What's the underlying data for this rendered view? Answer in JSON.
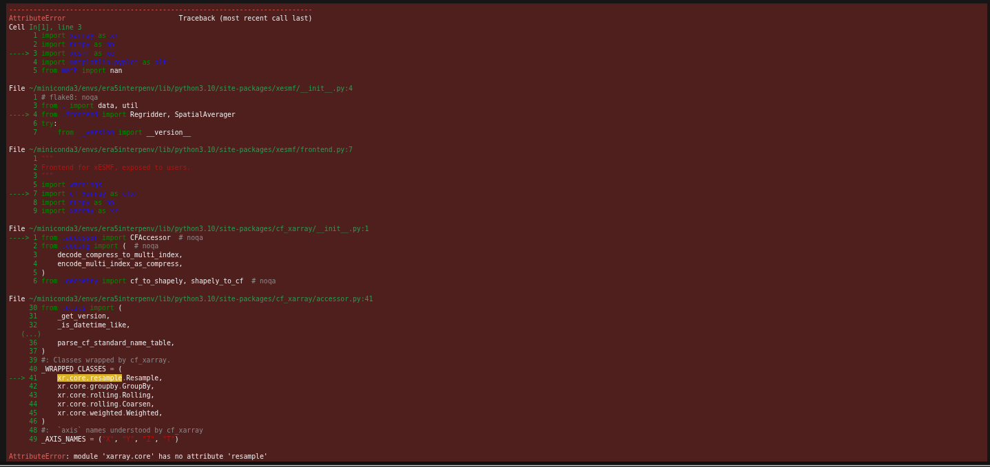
{
  "traceback": {
    "blocks": [
      {
        "lines": [
          {
            "segments": [
              {
                "kind": "err",
                "text": "---------------------------------------------------------------------------"
              }
            ]
          },
          {
            "segments": [
              {
                "kind": "err",
                "text": "AttributeError"
              },
              {
                "kind": "plain",
                "text": "                            Traceback (most recent call last)"
              }
            ]
          },
          {
            "segments": [
              {
                "kind": "plain",
                "text": "Cell "
              },
              {
                "kind": "path",
                "text": "In[1], line 3"
              }
            ]
          },
          {
            "segments": [
              {
                "kind": "num",
                "text": "      1 "
              },
              {
                "kind": "kw",
                "text": "import"
              },
              {
                "kind": "mod",
                "text": " xarray"
              },
              {
                "kind": "kw",
                "text": " as"
              },
              {
                "kind": "mod",
                "text": " xr"
              }
            ]
          },
          {
            "segments": [
              {
                "kind": "num",
                "text": "      2 "
              },
              {
                "kind": "kw",
                "text": "import"
              },
              {
                "kind": "mod",
                "text": " numpy"
              },
              {
                "kind": "kw",
                "text": " as"
              },
              {
                "kind": "mod",
                "text": " np"
              }
            ]
          },
          {
            "segments": [
              {
                "kind": "num",
                "text": "----> 3 "
              },
              {
                "kind": "kw",
                "text": "import"
              },
              {
                "kind": "mod",
                "text": " xesmf"
              },
              {
                "kind": "kw",
                "text": " as"
              },
              {
                "kind": "mod",
                "text": " xe"
              }
            ]
          },
          {
            "segments": [
              {
                "kind": "num",
                "text": "      4 "
              },
              {
                "kind": "kw",
                "text": "import"
              },
              {
                "kind": "mod",
                "text": " matplotlib.pyplot"
              },
              {
                "kind": "kw",
                "text": " as"
              },
              {
                "kind": "mod",
                "text": " plt"
              }
            ]
          },
          {
            "segments": [
              {
                "kind": "num",
                "text": "      5 "
              },
              {
                "kind": "kw",
                "text": "from"
              },
              {
                "kind": "mod",
                "text": " math"
              },
              {
                "kind": "kw",
                "text": " import"
              },
              {
                "kind": "plain",
                "text": " nan"
              }
            ]
          }
        ]
      },
      {
        "lines": [
          {
            "segments": [
              {
                "kind": "plain",
                "text": "File "
              },
              {
                "kind": "path",
                "text": "~/miniconda3/envs/era5interpenv/lib/python3.10/site-packages/xesmf/__init__.py:4"
              }
            ]
          },
          {
            "segments": [
              {
                "kind": "num",
                "text": "      1 "
              },
              {
                "kind": "cm",
                "text": "# flake8: noqa"
              }
            ]
          },
          {
            "segments": [
              {
                "kind": "num",
                "text": "      3 "
              },
              {
                "kind": "kw",
                "text": "from"
              },
              {
                "kind": "mod",
                "text": " ."
              },
              {
                "kind": "kw",
                "text": " import"
              },
              {
                "kind": "plain",
                "text": " data, util"
              }
            ]
          },
          {
            "segments": [
              {
                "kind": "num",
                "text": "----> 4 "
              },
              {
                "kind": "kw",
                "text": "from"
              },
              {
                "kind": "mod",
                "text": " .frontend"
              },
              {
                "kind": "kw",
                "text": " import"
              },
              {
                "kind": "plain",
                "text": " Regridder, SpatialAverager"
              }
            ]
          },
          {
            "segments": [
              {
                "kind": "num",
                "text": "      6 "
              },
              {
                "kind": "kw",
                "text": "try"
              },
              {
                "kind": "plain",
                "text": ":"
              }
            ]
          },
          {
            "segments": [
              {
                "kind": "num",
                "text": "      7     "
              },
              {
                "kind": "kw",
                "text": "from"
              },
              {
                "kind": "mod",
                "text": " ._version"
              },
              {
                "kind": "kw",
                "text": " import"
              },
              {
                "kind": "plain",
                "text": " __version__"
              }
            ]
          }
        ]
      },
      {
        "lines": [
          {
            "segments": [
              {
                "kind": "plain",
                "text": "File "
              },
              {
                "kind": "path",
                "text": "~/miniconda3/envs/era5interpenv/lib/python3.10/site-packages/xesmf/frontend.py:7"
              }
            ]
          },
          {
            "segments": [
              {
                "kind": "num",
                "text": "      1 "
              },
              {
                "kind": "str",
                "text": "\"\"\""
              }
            ]
          },
          {
            "segments": [
              {
                "kind": "num",
                "text": "      2 "
              },
              {
                "kind": "str",
                "text": "Frontend for xESMF, exposed to users."
              }
            ]
          },
          {
            "segments": [
              {
                "kind": "num",
                "text": "      3 "
              },
              {
                "kind": "str",
                "text": "\"\"\""
              }
            ]
          },
          {
            "segments": [
              {
                "kind": "num",
                "text": "      5 "
              },
              {
                "kind": "kw",
                "text": "import"
              },
              {
                "kind": "mod",
                "text": " warnings"
              }
            ]
          },
          {
            "segments": [
              {
                "kind": "num",
                "text": "----> 7 "
              },
              {
                "kind": "kw",
                "text": "import"
              },
              {
                "kind": "mod",
                "text": " cf_xarray"
              },
              {
                "kind": "kw",
                "text": " as"
              },
              {
                "kind": "mod",
                "text": " cfxr"
              }
            ]
          },
          {
            "segments": [
              {
                "kind": "num",
                "text": "      8 "
              },
              {
                "kind": "kw",
                "text": "import"
              },
              {
                "kind": "mod",
                "text": " numpy"
              },
              {
                "kind": "kw",
                "text": " as"
              },
              {
                "kind": "mod",
                "text": " np"
              }
            ]
          },
          {
            "segments": [
              {
                "kind": "num",
                "text": "      9 "
              },
              {
                "kind": "kw",
                "text": "import"
              },
              {
                "kind": "mod",
                "text": " xarray"
              },
              {
                "kind": "kw",
                "text": " as"
              },
              {
                "kind": "mod",
                "text": " xr"
              }
            ]
          }
        ]
      },
      {
        "lines": [
          {
            "segments": [
              {
                "kind": "plain",
                "text": "File "
              },
              {
                "kind": "path",
                "text": "~/miniconda3/envs/era5interpenv/lib/python3.10/site-packages/cf_xarray/__init__.py:1"
              }
            ]
          },
          {
            "segments": [
              {
                "kind": "num",
                "text": "----> 1 "
              },
              {
                "kind": "kw",
                "text": "from"
              },
              {
                "kind": "mod",
                "text": " .accessor"
              },
              {
                "kind": "kw",
                "text": " import"
              },
              {
                "kind": "plain",
                "text": " CFAccessor  "
              },
              {
                "kind": "cm",
                "text": "# noqa"
              }
            ]
          },
          {
            "segments": [
              {
                "kind": "num",
                "text": "      2 "
              },
              {
                "kind": "kw",
                "text": "from"
              },
              {
                "kind": "mod",
                "text": " .coding"
              },
              {
                "kind": "kw",
                "text": " import"
              },
              {
                "kind": "plain",
                "text": " (  "
              },
              {
                "kind": "cm",
                "text": "# noqa"
              }
            ]
          },
          {
            "segments": [
              {
                "kind": "num",
                "text": "      3 "
              },
              {
                "kind": "plain",
                "text": "    decode_compress_to_multi_index,"
              }
            ]
          },
          {
            "segments": [
              {
                "kind": "num",
                "text": "      4 "
              },
              {
                "kind": "plain",
                "text": "    encode_multi_index_as_compress,"
              }
            ]
          },
          {
            "segments": [
              {
                "kind": "num",
                "text": "      5 "
              },
              {
                "kind": "plain",
                "text": ")"
              }
            ]
          },
          {
            "segments": [
              {
                "kind": "num",
                "text": "      6 "
              },
              {
                "kind": "kw",
                "text": "from"
              },
              {
                "kind": "mod",
                "text": " .geometry"
              },
              {
                "kind": "kw",
                "text": " import"
              },
              {
                "kind": "plain",
                "text": " cf_to_shapely, shapely_to_cf  "
              },
              {
                "kind": "cm",
                "text": "# noqa"
              }
            ]
          }
        ]
      },
      {
        "lines": [
          {
            "segments": [
              {
                "kind": "plain",
                "text": "File "
              },
              {
                "kind": "path",
                "text": "~/miniconda3/envs/era5interpenv/lib/python3.10/site-packages/cf_xarray/accessor.py:41"
              }
            ]
          },
          {
            "segments": [
              {
                "kind": "num",
                "text": "     30 "
              },
              {
                "kind": "kw",
                "text": "from"
              },
              {
                "kind": "mod",
                "text": " .utils"
              },
              {
                "kind": "kw",
                "text": " import"
              },
              {
                "kind": "plain",
                "text": " ("
              }
            ]
          },
          {
            "segments": [
              {
                "kind": "num",
                "text": "     31 "
              },
              {
                "kind": "plain",
                "text": "    _get_version,"
              }
            ]
          },
          {
            "segments": [
              {
                "kind": "num",
                "text": "     32 "
              },
              {
                "kind": "plain",
                "text": "    _is_datetime_like,"
              }
            ]
          },
          {
            "segments": [
              {
                "kind": "num",
                "text": "   (...)"
              }
            ]
          },
          {
            "segments": [
              {
                "kind": "num",
                "text": "     36 "
              },
              {
                "kind": "plain",
                "text": "    parse_cf_standard_name_table,"
              }
            ]
          },
          {
            "segments": [
              {
                "kind": "num",
                "text": "     37 "
              },
              {
                "kind": "plain",
                "text": ")"
              }
            ]
          },
          {
            "segments": [
              {
                "kind": "num",
                "text": "     39 "
              },
              {
                "kind": "cm",
                "text": "#: Classes wrapped by cf_xarray."
              }
            ]
          },
          {
            "segments": [
              {
                "kind": "num",
                "text": "     40 "
              },
              {
                "kind": "plain",
                "text": "_WRAPPED_CLASSES "
              },
              {
                "kind": "op",
                "text": "="
              },
              {
                "kind": "plain",
                "text": " ("
              }
            ]
          },
          {
            "segments": [
              {
                "kind": "num",
                "text": "---> 41     "
              },
              {
                "kind": "hl",
                "text": "xr.core.resample"
              },
              {
                "kind": "op",
                "text": "."
              },
              {
                "kind": "plain",
                "text": "Resample,"
              }
            ]
          },
          {
            "segments": [
              {
                "kind": "num",
                "text": "     42 "
              },
              {
                "kind": "plain",
                "text": "    xr"
              },
              {
                "kind": "op",
                "text": "."
              },
              {
                "kind": "plain",
                "text": "core"
              },
              {
                "kind": "op",
                "text": "."
              },
              {
                "kind": "plain",
                "text": "groupby"
              },
              {
                "kind": "op",
                "text": "."
              },
              {
                "kind": "plain",
                "text": "GroupBy,"
              }
            ]
          },
          {
            "segments": [
              {
                "kind": "num",
                "text": "     43 "
              },
              {
                "kind": "plain",
                "text": "    xr"
              },
              {
                "kind": "op",
                "text": "."
              },
              {
                "kind": "plain",
                "text": "core"
              },
              {
                "kind": "op",
                "text": "."
              },
              {
                "kind": "plain",
                "text": "rolling"
              },
              {
                "kind": "op",
                "text": "."
              },
              {
                "kind": "plain",
                "text": "Rolling,"
              }
            ]
          },
          {
            "segments": [
              {
                "kind": "num",
                "text": "     44 "
              },
              {
                "kind": "plain",
                "text": "    xr"
              },
              {
                "kind": "op",
                "text": "."
              },
              {
                "kind": "plain",
                "text": "core"
              },
              {
                "kind": "op",
                "text": "."
              },
              {
                "kind": "plain",
                "text": "rolling"
              },
              {
                "kind": "op",
                "text": "."
              },
              {
                "kind": "plain",
                "text": "Coarsen,"
              }
            ]
          },
          {
            "segments": [
              {
                "kind": "num",
                "text": "     45 "
              },
              {
                "kind": "plain",
                "text": "    xr"
              },
              {
                "kind": "op",
                "text": "."
              },
              {
                "kind": "plain",
                "text": "core"
              },
              {
                "kind": "op",
                "text": "."
              },
              {
                "kind": "plain",
                "text": "weighted"
              },
              {
                "kind": "op",
                "text": "."
              },
              {
                "kind": "plain",
                "text": "Weighted,"
              }
            ]
          },
          {
            "segments": [
              {
                "kind": "num",
                "text": "     46 "
              },
              {
                "kind": "plain",
                "text": ")"
              }
            ]
          },
          {
            "segments": [
              {
                "kind": "num",
                "text": "     48 "
              },
              {
                "kind": "cm",
                "text": "#:  `axis` names understood by cf_xarray"
              }
            ]
          },
          {
            "segments": [
              {
                "kind": "num",
                "text": "     49 "
              },
              {
                "kind": "plain",
                "text": "_AXIS_NAMES "
              },
              {
                "kind": "op",
                "text": "="
              },
              {
                "kind": "plain",
                "text": " ("
              },
              {
                "kind": "str",
                "text": "\"X\""
              },
              {
                "kind": "plain",
                "text": ", "
              },
              {
                "kind": "str",
                "text": "\"Y\""
              },
              {
                "kind": "plain",
                "text": ", "
              },
              {
                "kind": "str",
                "text": "\"Z\""
              },
              {
                "kind": "plain",
                "text": ", "
              },
              {
                "kind": "str",
                "text": "\"T\""
              },
              {
                "kind": "plain",
                "text": ")"
              }
            ]
          }
        ]
      },
      {
        "lines": [
          {
            "segments": [
              {
                "kind": "err",
                "text": "AttributeError"
              },
              {
                "kind": "plain",
                "text": ": module 'xarray.core' has no attribute 'resample'"
              }
            ]
          }
        ]
      }
    ]
  }
}
